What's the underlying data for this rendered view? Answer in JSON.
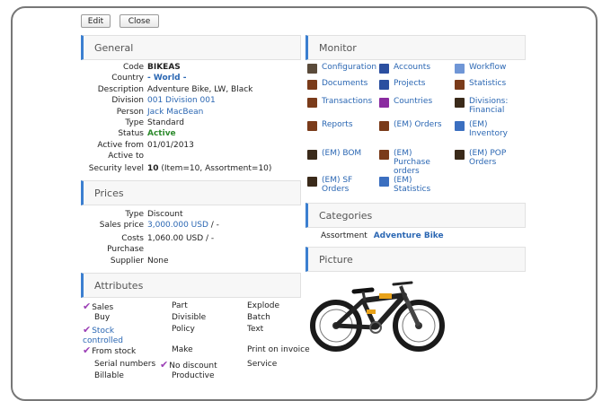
{
  "toolbar": {
    "edit_label": "Edit",
    "close_label": "Close"
  },
  "general": {
    "title": "General",
    "fields": [
      {
        "label": "Code",
        "value": "BIKEAS",
        "style": "bold"
      },
      {
        "label": "Country",
        "value": "- World -",
        "style": "link-bold"
      },
      {
        "label": "Description",
        "value": "Adventure Bike, LW, Black",
        "style": "plain"
      },
      {
        "label": "Division",
        "value": "001 Division 001",
        "style": "link"
      },
      {
        "label": "Person",
        "value": "Jack MacBean",
        "style": "link"
      },
      {
        "label": "Type",
        "value": "Standard",
        "style": "plain"
      },
      {
        "label": "Status",
        "value": "Active",
        "style": "green"
      },
      {
        "label": "Active from",
        "value": "01/01/2013",
        "style": "plain"
      },
      {
        "label": "Active to",
        "value": "",
        "style": "plain"
      }
    ],
    "security": {
      "label": "Security level",
      "value_bold": "10",
      "value_rest": " (Item=10, Assortment=10)"
    }
  },
  "prices": {
    "title": "Prices",
    "type": {
      "label": "Type",
      "value": "Discount"
    },
    "sales_price": {
      "label": "Sales price",
      "amount": "3,000.000 USD",
      "suffix": " / -"
    },
    "costs": {
      "label": "Costs",
      "value": "1,060.00 USD / -"
    },
    "purchase": {
      "label": "Purchase"
    },
    "supplier": {
      "label": "Supplier",
      "value": "None"
    }
  },
  "attributes": {
    "title": "Attributes",
    "items": [
      {
        "text": "Sales",
        "checked": true
      },
      {
        "text": "Part",
        "checked": false
      },
      {
        "text": "Explode",
        "checked": false
      },
      {
        "text": "Buy",
        "checked": false
      },
      {
        "text": "Divisible",
        "checked": false
      },
      {
        "text": "Batch",
        "checked": false
      },
      {
        "text": "Stock controlled",
        "checked": true
      },
      {
        "text": "Policy",
        "checked": false
      },
      {
        "text": "Text",
        "checked": false
      },
      {
        "text": "From stock",
        "checked": true
      },
      {
        "text": "Make",
        "checked": false
      },
      {
        "text": "Print on invoice",
        "checked": false
      },
      {
        "text": "Serial numbers",
        "checked": false
      },
      {
        "text": "No discount",
        "checked": true
      },
      {
        "text": "Service",
        "checked": false
      },
      {
        "text": "Billable",
        "checked": false
      },
      {
        "text": "Productive",
        "checked": false
      }
    ]
  },
  "monitor": {
    "title": "Monitor",
    "items": [
      {
        "label": "Configuration",
        "icon": "wrench-icon",
        "color": "#5a4a3a"
      },
      {
        "label": "Accounts",
        "icon": "accounts-icon",
        "color": "#2b4fa0"
      },
      {
        "label": "Workflow",
        "icon": "workflow-icon",
        "color": "#6f96d6"
      },
      {
        "label": "Documents",
        "icon": "book-icon",
        "color": "#7a3b1a"
      },
      {
        "label": "Projects",
        "icon": "projects-icon",
        "color": "#2b4fa0"
      },
      {
        "label": "Statistics",
        "icon": "book-icon",
        "color": "#7a3b1a"
      },
      {
        "label": "Transactions",
        "icon": "book-icon",
        "color": "#7a3b1a"
      },
      {
        "label": "Countries",
        "icon": "globe-icon",
        "color": "#8a2ba0"
      },
      {
        "label": "Divisions: Financial",
        "icon": "book-icon",
        "color": "#3a2a1a"
      },
      {
        "label": "Reports",
        "icon": "book-icon",
        "color": "#7a3b1a"
      },
      {
        "label": "(EM) Orders",
        "icon": "book-icon",
        "color": "#7a3b1a"
      },
      {
        "label": "(EM) Inventory",
        "icon": "chart-icon",
        "color": "#3b6fc0"
      },
      {
        "label": "(EM) BOM",
        "icon": "book-icon",
        "color": "#3a2a1a"
      },
      {
        "label": "(EM) Purchase orders",
        "icon": "book-icon",
        "color": "#7a3b1a"
      },
      {
        "label": "(EM) POP Orders",
        "icon": "book-icon",
        "color": "#3a2a1a"
      },
      {
        "label": "(EM) SF Orders",
        "icon": "book-icon",
        "color": "#3a2a1a"
      },
      {
        "label": "(EM) Statistics",
        "icon": "chart-icon",
        "color": "#3b6fc0"
      }
    ]
  },
  "categories": {
    "title": "Categories",
    "assortment_label": "Assortment",
    "assortment_value": "Adventure Bike"
  },
  "picture": {
    "title": "Picture"
  }
}
